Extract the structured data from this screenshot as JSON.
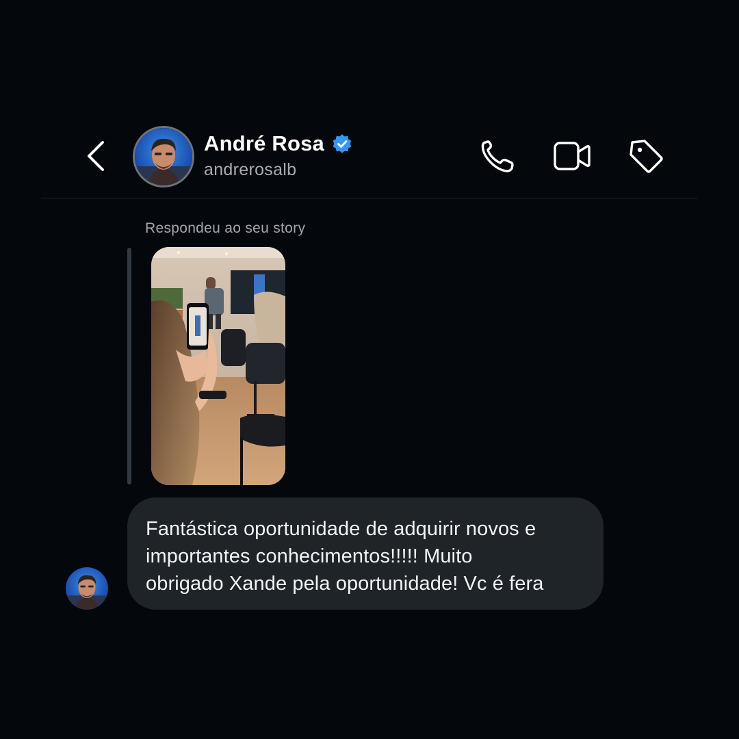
{
  "header": {
    "contact_name": "André Rosa",
    "username": "andrerosalb",
    "verified": true,
    "icons": [
      "back-arrow-icon",
      "verified-badge-icon",
      "phone-icon",
      "video-camera-icon",
      "tag-icon"
    ]
  },
  "conversation": {
    "story_reply_caption": "Respondeu ao seu story",
    "message": {
      "line1": "Fantástica oportunidade de adquirir novos e",
      "line2": "importantes conhecimentos!!!!! Muito",
      "line3": "obrigado Xande pela oportunidade! Vc é fera"
    }
  },
  "colors": {
    "background": "#04070b",
    "bubble": "#1f2429",
    "verified_blue": "#3797f0",
    "secondary_text": "#a6acb3"
  }
}
